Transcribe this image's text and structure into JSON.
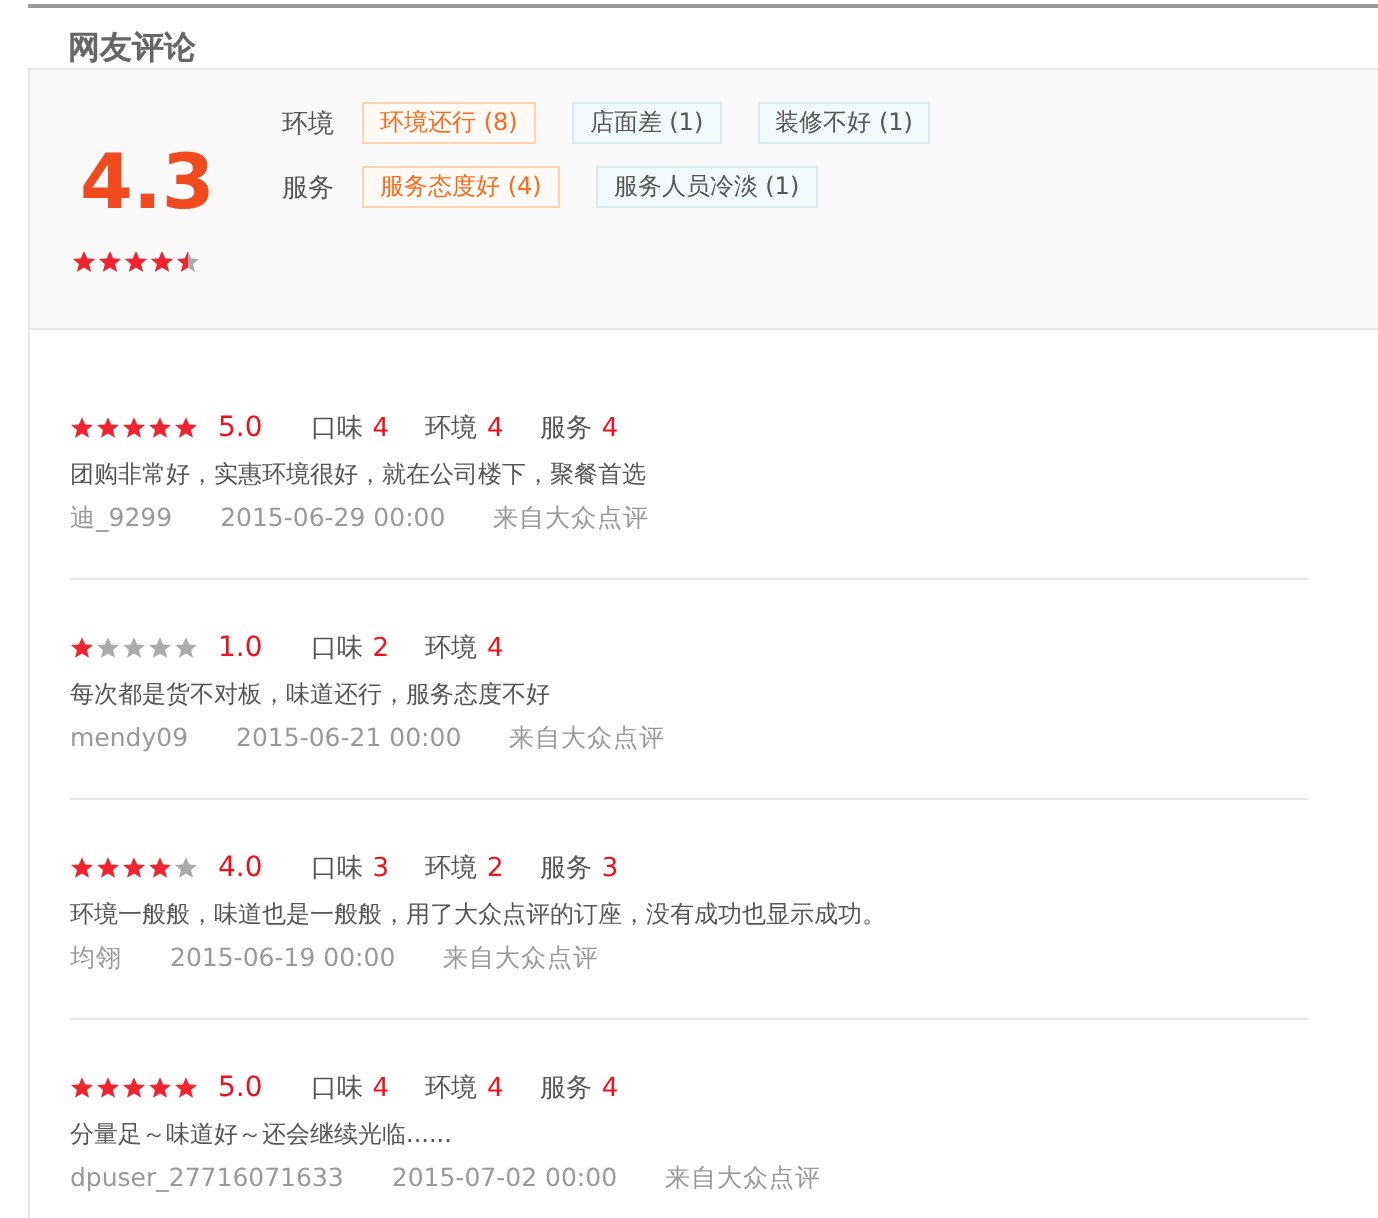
{
  "section_title": "网友评论",
  "summary": {
    "score": "4.3",
    "stars": 4.5,
    "groups": [
      {
        "label": "环境",
        "tags": [
          {
            "text": "环境还行 (8)",
            "kind": "positive"
          },
          {
            "text": "店面差 (1)",
            "kind": "negative"
          },
          {
            "text": "装修不好 (1)",
            "kind": "negative"
          }
        ]
      },
      {
        "label": "服务",
        "tags": [
          {
            "text": "服务态度好 (4)",
            "kind": "positive"
          },
          {
            "text": "服务人员冷淡 (1)",
            "kind": "negative"
          }
        ]
      }
    ]
  },
  "reviews": [
    {
      "stars": 5,
      "score": "5.0",
      "ratings": [
        {
          "label": "口味",
          "value": "4"
        },
        {
          "label": "环境",
          "value": "4"
        },
        {
          "label": "服务",
          "value": "4"
        }
      ],
      "text": "团购非常好，实惠环境很好，就在公司楼下，聚餐首选",
      "user": "迪_9299",
      "date": "2015-06-29 00:00",
      "source": "来自大众点评"
    },
    {
      "stars": 1,
      "score": "1.0",
      "ratings": [
        {
          "label": "口味",
          "value": "2"
        },
        {
          "label": "环境",
          "value": "4"
        }
      ],
      "text": "每次都是货不对板，味道还行，服务态度不好",
      "user": "mendy09",
      "date": "2015-06-21 00:00",
      "source": "来自大众点评"
    },
    {
      "stars": 4,
      "score": "4.0",
      "ratings": [
        {
          "label": "口味",
          "value": "3"
        },
        {
          "label": "环境",
          "value": "2"
        },
        {
          "label": "服务",
          "value": "3"
        }
      ],
      "text": "环境一般般，味道也是一般般，用了大众点评的订座，没有成功也显示成功。",
      "user": "均翎",
      "date": "2015-06-19 00:00",
      "source": "来自大众点评"
    },
    {
      "stars": 5,
      "score": "5.0",
      "ratings": [
        {
          "label": "口味",
          "value": "4"
        },
        {
          "label": "环境",
          "value": "4"
        },
        {
          "label": "服务",
          "value": "4"
        }
      ],
      "text": "分量足～味道好～还会继续光临......",
      "user": "dpuser_27716071633",
      "date": "2015-07-02 00:00",
      "source": "来自大众点评"
    }
  ]
}
